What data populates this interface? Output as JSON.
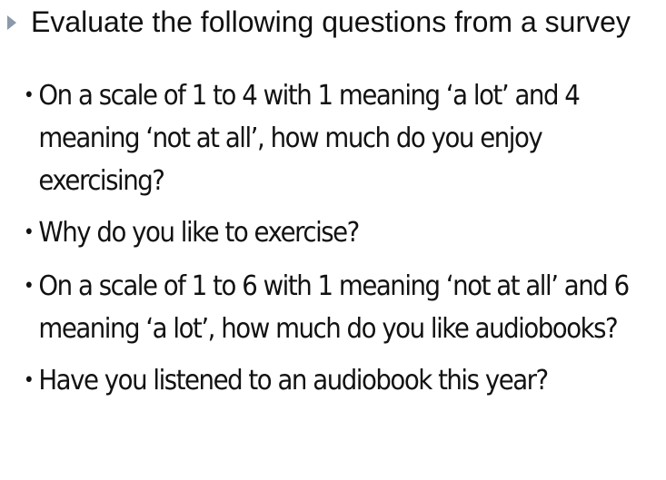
{
  "slide": {
    "heading": "Evaluate the following questions from a survey",
    "questions": [
      "On a scale of 1 to 4 with 1 meaning ‘a lot’ and 4 meaning ‘not at all’, how much do you enjoy exercising?",
      "Why do you like to exercise?",
      "On a scale of 1 to 6 with 1 meaning ‘not at all’ and 6 meaning ‘a lot’, how much do you like audiobooks?",
      "Have you listened to an audiobook this year?"
    ],
    "bullet_glyph": "•",
    "colors": {
      "text": "#111111",
      "heading_marker": "#8a9aaa",
      "background": "#ffffff"
    },
    "icons": {
      "heading_marker": "triangle-right-bullet-icon",
      "list_bullet": "dot-bullet-icon"
    }
  }
}
